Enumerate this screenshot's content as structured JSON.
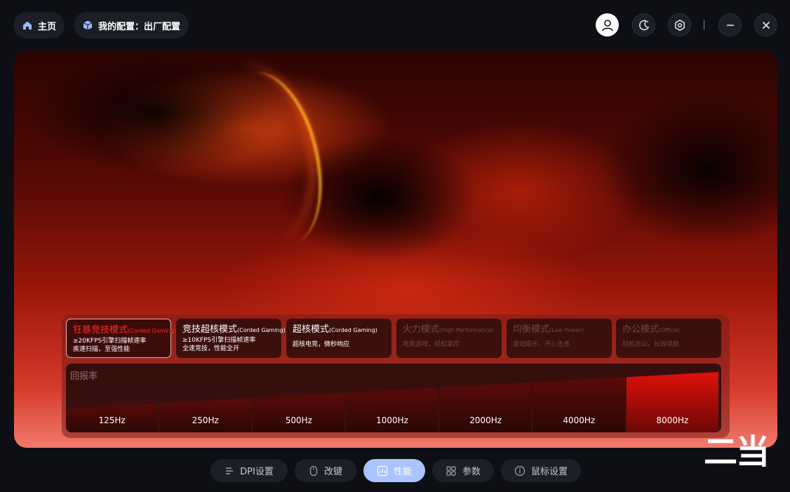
{
  "topbar": {
    "home_label": "主页",
    "config_label": "我的配置：出厂配置"
  },
  "modes": [
    {
      "title": "狂暴竞技模式",
      "sub": "(Corded Gaming)",
      "line2": "≥20KFPS引擎扫描帧速率",
      "line3": "疾速扫描，至强性能",
      "state": "active"
    },
    {
      "title": "竞技超核模式",
      "sub": "(Corded Gaming)",
      "line2": "≥10KFPS引擎扫描帧速率",
      "line3": "全速竞技，性能全开",
      "state": "normal"
    },
    {
      "title": "超核模式",
      "sub": "(Corded Gaming)",
      "line2": "超核电竞，微秒响应",
      "line3": "",
      "state": "normal"
    },
    {
      "title": "火力模式",
      "sub": "(High Performance)",
      "line2": "电竞游戏，轻松掌控",
      "line3": "",
      "state": "dim"
    },
    {
      "title": "均衡模式",
      "sub": "(Low Power)",
      "line2": "游戏娱乐，开心无虑",
      "line3": "",
      "state": "dim"
    },
    {
      "title": "办公模式",
      "sub": "(Office)",
      "line2": "轻松办公，长效续航",
      "line3": "",
      "state": "dim"
    }
  ],
  "polling": {
    "label": "回报率",
    "options": [
      "125Hz",
      "250Hz",
      "500Hz",
      "1000Hz",
      "2000Hz",
      "4000Hz",
      "8000Hz"
    ],
    "selected": "8000Hz"
  },
  "bottom_nav": [
    {
      "label": "DPI设置",
      "icon": "dpi-icon",
      "active": false
    },
    {
      "label": "改键",
      "icon": "mouse-icon",
      "active": false
    },
    {
      "label": "性能",
      "icon": "performance-icon",
      "active": true
    },
    {
      "label": "参数",
      "icon": "parameters-icon",
      "active": false
    },
    {
      "label": "鼠标设置",
      "icon": "info-icon",
      "active": false
    }
  ],
  "watermark": "二当",
  "colors": {
    "accent": "#a9c4ff",
    "active_mode": "#ff2a1e",
    "selected_bar": "#e0100b"
  }
}
